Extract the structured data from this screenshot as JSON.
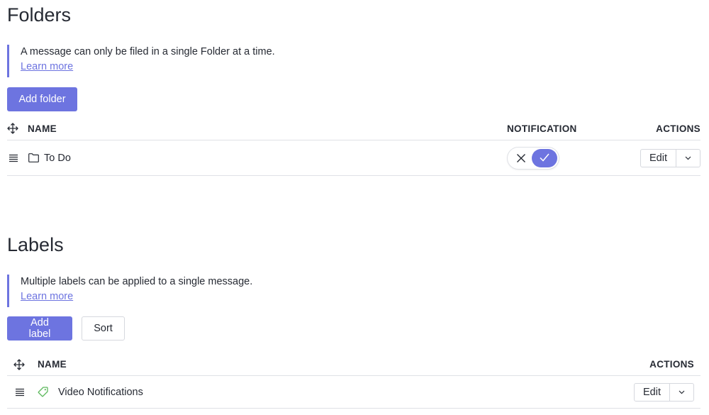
{
  "folders": {
    "title": "Folders",
    "info_text": "A message can only be filed in a single Folder at a time.",
    "learn_more": "Learn more",
    "add_button": "Add folder",
    "columns": {
      "name": "NAME",
      "notification": "NOTIFICATION",
      "actions": "ACTIONS"
    },
    "rows": [
      {
        "name": "To Do",
        "icon": "folder-icon",
        "notification": true,
        "edit_label": "Edit"
      }
    ]
  },
  "labels": {
    "title": "Labels",
    "info_text": "Multiple labels can be applied to a single message.",
    "learn_more": "Learn more",
    "add_button": "Add label",
    "sort_button": "Sort",
    "columns": {
      "name": "NAME",
      "actions": "ACTIONS"
    },
    "rows": [
      {
        "name": "Video Notifications",
        "icon": "tag-icon",
        "icon_color": "#5cb85c",
        "edit_label": "Edit"
      }
    ]
  },
  "colors": {
    "accent": "#6d74e0",
    "label_green": "#5cb85c",
    "border": "#dfe1e6"
  }
}
